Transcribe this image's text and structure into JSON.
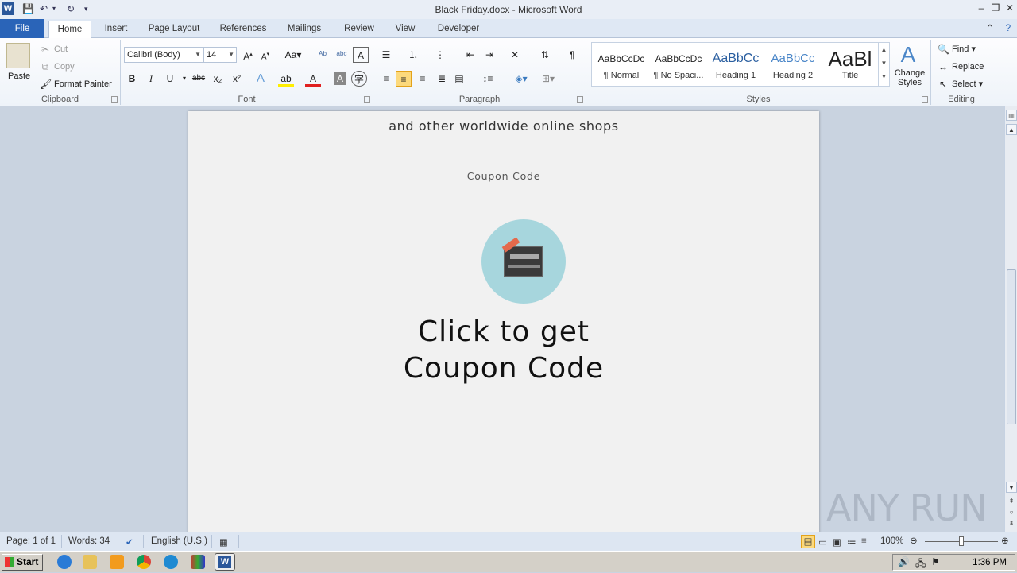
{
  "window": {
    "title": "Black Friday.docx - Microsoft Word",
    "app_icon": "W"
  },
  "tabs": [
    "File",
    "Home",
    "Insert",
    "Page Layout",
    "References",
    "Mailings",
    "Review",
    "View",
    "Developer"
  ],
  "active_tab": "Home",
  "clipboard": {
    "paste": "Paste",
    "cut": "Cut",
    "copy": "Copy",
    "format_painter": "Format Painter",
    "label": "Clipboard"
  },
  "font": {
    "name": "Calibri (Body)",
    "size": "14",
    "label": "Font",
    "bold": "B",
    "italic": "I",
    "underline": "U"
  },
  "paragraph": {
    "label": "Paragraph"
  },
  "styles": {
    "label": "Styles",
    "items": [
      {
        "preview": "AaBbCcDc",
        "name": "¶ Normal"
      },
      {
        "preview": "AaBbCcDc",
        "name": "¶ No Spaci..."
      },
      {
        "preview": "AaBbCc",
        "name": "Heading 1"
      },
      {
        "preview": "AaBbCc",
        "name": "Heading 2"
      },
      {
        "preview": "AaBl",
        "name": "Title"
      }
    ],
    "change_styles": "Change Styles"
  },
  "editing": {
    "label": "Editing",
    "find": "Find",
    "replace": "Replace",
    "select": "Select"
  },
  "document": {
    "line1": "and other worldwide online shops",
    "coupon_caption": "Coupon Code",
    "cta_line1": "Click to get",
    "cta_line2": "Coupon Code"
  },
  "status": {
    "page": "Page: 1 of 1",
    "words": "Words: 34",
    "language": "English (U.S.)",
    "zoom": "100%"
  },
  "taskbar": {
    "start": "Start",
    "clock": "1:36 PM"
  },
  "watermark": "ANY RUN",
  "colors": {
    "file_tab": "#2a64b8",
    "badge": "#a7d6dd",
    "selected_align": "#fcd97c"
  }
}
